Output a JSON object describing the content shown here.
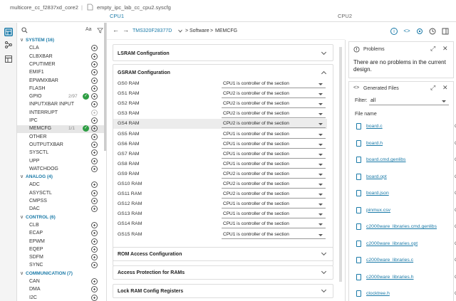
{
  "titlebar": {
    "project": "multicore_cc_f2837xd_core2",
    "separator": "|",
    "file": "empty_ipc_lab_cc_cpu2.syscfg"
  },
  "cpu_tabs": [
    "CPU1",
    "CPU2"
  ],
  "sidebar": {
    "search_placeholder": "",
    "aa_label": "Aa",
    "categories": [
      {
        "label": "SYSTEM (16)",
        "items": [
          {
            "label": "CLA"
          },
          {
            "label": "CLBXBAR"
          },
          {
            "label": "CPUTIMER"
          },
          {
            "label": "EMIF1"
          },
          {
            "label": "EPWMXBAR"
          },
          {
            "label": "FLASH"
          },
          {
            "label": "GPIO",
            "count": "2/97",
            "check": true
          },
          {
            "label": "INPUTXBAR INPUT"
          },
          {
            "label": "INTERRUPT",
            "dim": true
          },
          {
            "label": "IPC"
          },
          {
            "label": "MEMCFG",
            "count": "1/1",
            "check": true,
            "selected": true
          },
          {
            "label": "OTHER"
          },
          {
            "label": "OUTPUTXBAR"
          },
          {
            "label": "SYSCTL"
          },
          {
            "label": "UPP"
          },
          {
            "label": "WATCHDOG"
          }
        ]
      },
      {
        "label": "ANALOG (4)",
        "items": [
          {
            "label": "ADC"
          },
          {
            "label": "ASYSCTL"
          },
          {
            "label": "CMPSS"
          },
          {
            "label": "DAC"
          }
        ]
      },
      {
        "label": "CONTROL (6)",
        "items": [
          {
            "label": "CLB"
          },
          {
            "label": "ECAP"
          },
          {
            "label": "EPWM"
          },
          {
            "label": "EQEP"
          },
          {
            "label": "SDFM"
          },
          {
            "label": "SYNC"
          }
        ]
      },
      {
        "label": "COMMUNICATION (7)",
        "items": [
          {
            "label": "CAN"
          },
          {
            "label": "DMA"
          },
          {
            "label": "I2C"
          }
        ]
      }
    ]
  },
  "nav": {
    "device": "TMS320F28377D",
    "sep": ">",
    "software": "Software",
    "page": "MEMCFG"
  },
  "main": {
    "lsram_title": "LSRAM Configuration",
    "gsram_title": "GSRAM Configuration",
    "gsram_rows": [
      {
        "name": "GS0 RAM",
        "value": "CPU1 is controller of the section"
      },
      {
        "name": "GS1 RAM",
        "value": "CPU2 is controller of the section"
      },
      {
        "name": "GS2 RAM",
        "value": "CPU2 is controller of the section"
      },
      {
        "name": "GS3 RAM",
        "value": "CPU2 is controller of the section"
      },
      {
        "name": "GS4 RAM",
        "value": "CPU2 is controller of the section",
        "highlight": true
      },
      {
        "name": "GS5 RAM",
        "value": "CPU1 is controller of the section"
      },
      {
        "name": "GS6 RAM",
        "value": "CPU1 is controller of the section"
      },
      {
        "name": "GS7 RAM",
        "value": "CPU1 is controller of the section"
      },
      {
        "name": "GS8 RAM",
        "value": "CPU1 is controller of the section"
      },
      {
        "name": "GS9 RAM",
        "value": "CPU2 is controller of the section"
      },
      {
        "name": "GS10 RAM",
        "value": "CPU2 is controller of the section"
      },
      {
        "name": "GS11 RAM",
        "value": "CPU2 is controller of the section"
      },
      {
        "name": "GS12 RAM",
        "value": "CPU1 is controller of the section"
      },
      {
        "name": "GS13 RAM",
        "value": "CPU1 is controller of the section"
      },
      {
        "name": "GS14 RAM",
        "value": "CPU1 is controller of the section"
      },
      {
        "name": "GS15 RAM",
        "value": "CPU1 is controller of the section"
      }
    ],
    "rom_title": "ROM Access Configuration",
    "protection_title": "Access Protection for RAMs",
    "lock_title": "Lock RAM Config Registers"
  },
  "problems": {
    "title": "Problems",
    "message": "There are no problems in the current design."
  },
  "generated": {
    "title": "Generated Files",
    "filter_label": "Filter:",
    "filter_value": "all",
    "column_header": "File name",
    "files": [
      {
        "name": "board.c",
        "tag": "C"
      },
      {
        "name": "board.h",
        "tag": "C"
      },
      {
        "name": "board.cmd.genlibs",
        "tag": "C"
      },
      {
        "name": "board.opt",
        "tag": "C"
      },
      {
        "name": "board.json",
        "tag": "C"
      },
      {
        "name": "pinmux.csv",
        "tag": "C"
      },
      {
        "name": "c2000ware_libraries.cmd.genlibs",
        "tag": "C"
      },
      {
        "name": "c2000ware_libraries.opt",
        "tag": "C"
      },
      {
        "name": "c2000ware_libraries.c",
        "tag": "C"
      },
      {
        "name": "c2000ware_libraries.h",
        "tag": "C"
      },
      {
        "name": "clocktree.h",
        "tag": "C"
      }
    ]
  },
  "colors": {
    "accent": "#1a7aa8",
    "check": "#2e9e44"
  }
}
